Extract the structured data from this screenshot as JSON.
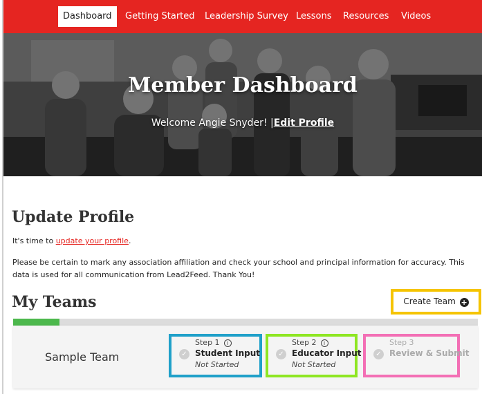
{
  "nav": {
    "items": [
      {
        "label": "Dashboard",
        "active": true
      },
      {
        "label": "Getting Started"
      },
      {
        "label": "Leadership Survey"
      },
      {
        "label": "Lessons"
      },
      {
        "label": "Resources"
      },
      {
        "label": "Videos"
      }
    ]
  },
  "hero": {
    "title": "Member Dashboard",
    "welcome": "Welcome Angie Snyder! |",
    "edit_profile": "Edit Profile"
  },
  "profile": {
    "heading": "Update Profile",
    "line1_prefix": "It's time to ",
    "line1_link": "update your profile",
    "line1_suffix": ".",
    "line2": "Please be certain to mark any association affiliation and check your school and principal information for accuracy. This data is used for all communication from Lead2Feed. Thank You!"
  },
  "teams": {
    "heading": "My Teams",
    "create_label": "Create Team",
    "progress_fraction": 0.1,
    "list": [
      {
        "name": "Sample Team",
        "steps": [
          {
            "label": "Step 1",
            "title": "Student Input",
            "status": "Not Started"
          },
          {
            "label": "Step 2",
            "title": "Educator Input",
            "status": "Not Started"
          },
          {
            "label": "Step 3",
            "title": "Review & Submit",
            "status": ""
          }
        ]
      }
    ]
  },
  "colors": {
    "brand_red": "#e52521",
    "highlight_yellow": "#f5c400",
    "highlight_blue": "#1fa0c9",
    "highlight_green": "#8ee622",
    "highlight_pink": "#f36fb5",
    "progress_green": "#4cb84c"
  },
  "icons": {
    "create": "plus-circle-icon",
    "step_done": "check-circle-icon",
    "info": "info-circle-icon"
  }
}
